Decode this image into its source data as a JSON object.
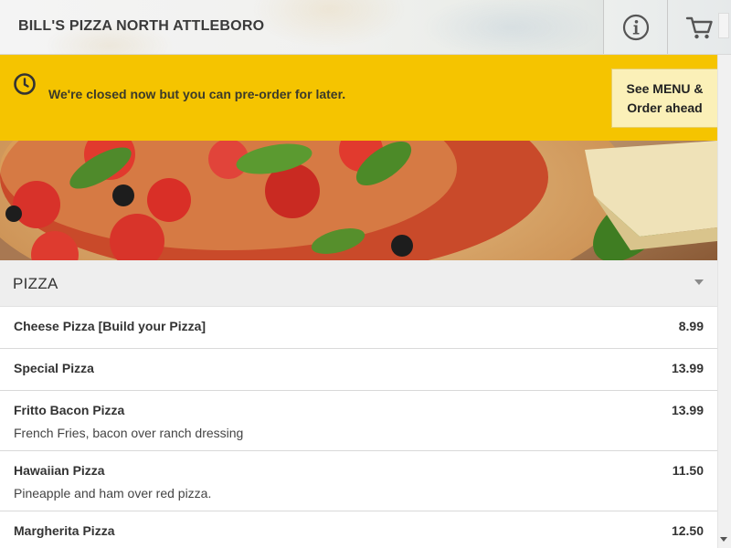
{
  "header": {
    "title": "BILL'S PIZZA NORTH ATTLEBORO",
    "info_icon": "info-icon",
    "cart_icon": "cart-icon"
  },
  "banner": {
    "icon": "clock-icon",
    "message": "We're closed now but you can pre-order for later.",
    "cta_line1": "See MENU &",
    "cta_line2": "Order ahead"
  },
  "section": {
    "title": "PIZZA",
    "toggle_icon": "caret-down-icon"
  },
  "items": [
    {
      "name": "Cheese Pizza [Build your Pizza]",
      "price": "8.99",
      "description": ""
    },
    {
      "name": "Special Pizza",
      "price": "13.99",
      "description": ""
    },
    {
      "name": "Fritto Bacon Pizza",
      "price": "13.99",
      "description": "French Fries, bacon over ranch dressing"
    },
    {
      "name": "Hawaiian Pizza",
      "price": "11.50",
      "description": "Pineapple and ham over red pizza."
    },
    {
      "name": "Margherita Pizza",
      "price": "12.50",
      "description": ""
    }
  ],
  "colors": {
    "banner": "#f5c400",
    "cta_background": "#fbf0b8",
    "section_header": "#eeeeee"
  }
}
